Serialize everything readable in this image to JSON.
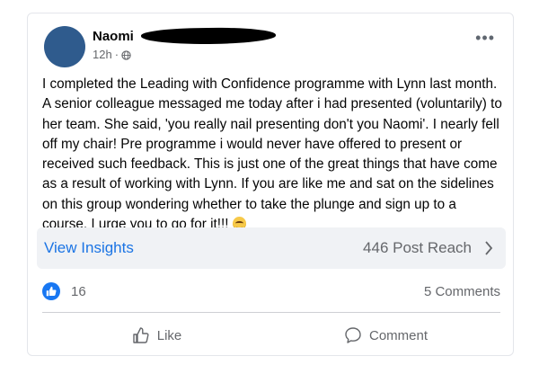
{
  "post": {
    "author_name": "Naomi",
    "timestamp": "12h",
    "separator": "·",
    "privacy_icon": "globe-icon",
    "more_icon": "more-options-icon",
    "text": "I completed the Leading with Confidence programme with Lynn last month. A senior colleague messaged me today after i had presented (voluntarily) to her team. She said, 'you really nail presenting don't you Naomi'. I nearly fell off my chair! Pre programme i would never have offered to present or received such feedback. This is just one of the great things that have come as a result of working with Lynn. If you are like me and sat on the sidelines on this group wondering whether to take the plunge and sign up to a course, I urge you to go for it!!!"
  },
  "insights": {
    "link_label": "View Insights",
    "reach_label": "446 Post Reach"
  },
  "stats": {
    "likes_count": "16",
    "comments_label": "5 Comments"
  },
  "actions": {
    "like_label": "Like",
    "comment_label": "Comment"
  },
  "colors": {
    "accent": "#1b74e4",
    "like_blue": "#1877f2",
    "muted_text": "#65676b",
    "insights_bg": "#f0f2f5"
  }
}
